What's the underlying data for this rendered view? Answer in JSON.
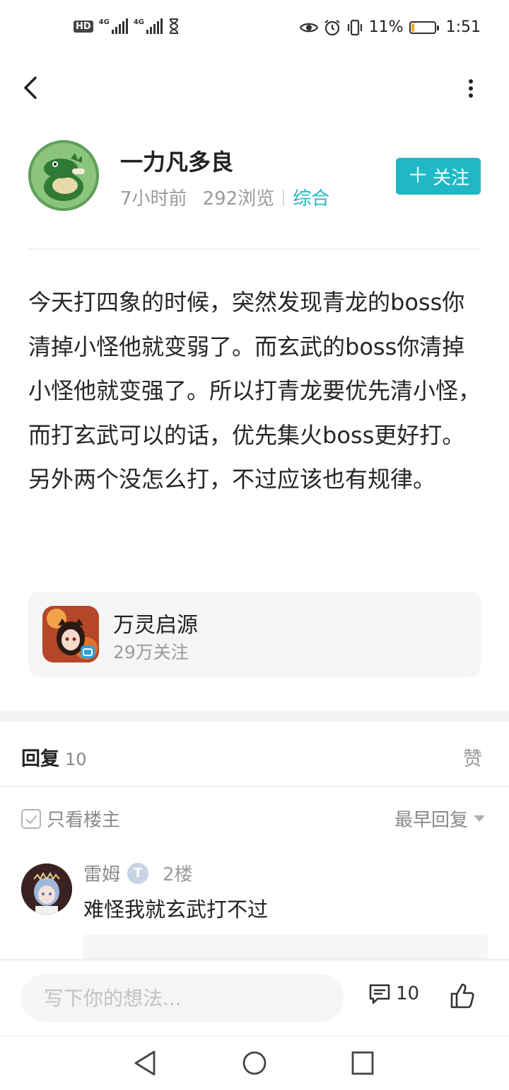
{
  "status_bar": {
    "hd": "HD",
    "sim1": "4G",
    "sim2": "4G",
    "battery_percent": "11%",
    "battery_level": 0.11,
    "time": "1:51"
  },
  "author": {
    "name": "一力凡多良",
    "time_ago": "7小时前",
    "views": "292浏览",
    "category": "综合",
    "follow_label": "关注"
  },
  "post": {
    "content": "今天打四象的时候，突然发现青龙的boss你清掉小怪他就变弱了。而玄武的boss你清掉小怪他就变强了。所以打青龙要优先清小怪，而打玄武可以的话，优先集火boss更好打。另外两个没怎么打，不过应该也有规律。"
  },
  "game_card": {
    "name": "万灵启源",
    "followers": "29万关注"
  },
  "replies": {
    "title": "回复",
    "count": "10",
    "like_label": "赞",
    "only_op": "只看楼主",
    "sort": "最早回复"
  },
  "comment": {
    "user": "雷姆",
    "badge": "T",
    "floor": "2楼",
    "text": "难怪我就玄武打不过"
  },
  "bottom_bar": {
    "input_placeholder": "写下你的想法...",
    "comment_count": "10"
  },
  "colors": {
    "accent": "#21b8c6",
    "battery": "#f5a623"
  }
}
